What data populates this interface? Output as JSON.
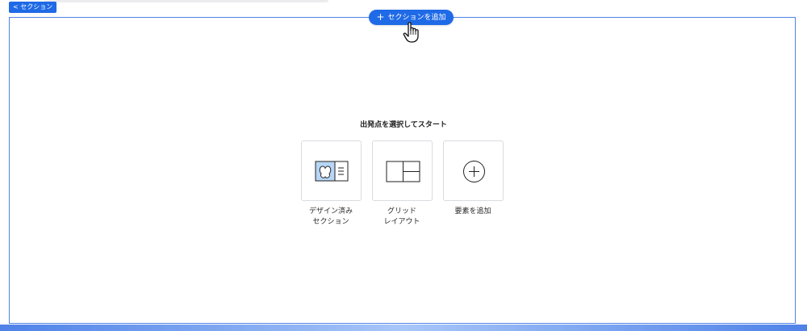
{
  "header": {
    "section_tag": "< セクション",
    "add_section_button": "セクションを追加"
  },
  "main": {
    "prompt": "出発点を選択してスタート",
    "options": [
      {
        "label_line1": "デザイン済み",
        "label_line2": "セクション",
        "icon": "designed-section-icon"
      },
      {
        "label_line1": "グリッド",
        "label_line2": "レイアウト",
        "icon": "grid-layout-icon"
      },
      {
        "label_line1": "要素を追加",
        "label_line2": "",
        "icon": "add-element-icon"
      }
    ]
  },
  "colors": {
    "accent": "#1f6ae6",
    "frame": "#4f82e8",
    "card_border": "#d9dbe0",
    "icon_highlight": "#b7d6f5"
  }
}
